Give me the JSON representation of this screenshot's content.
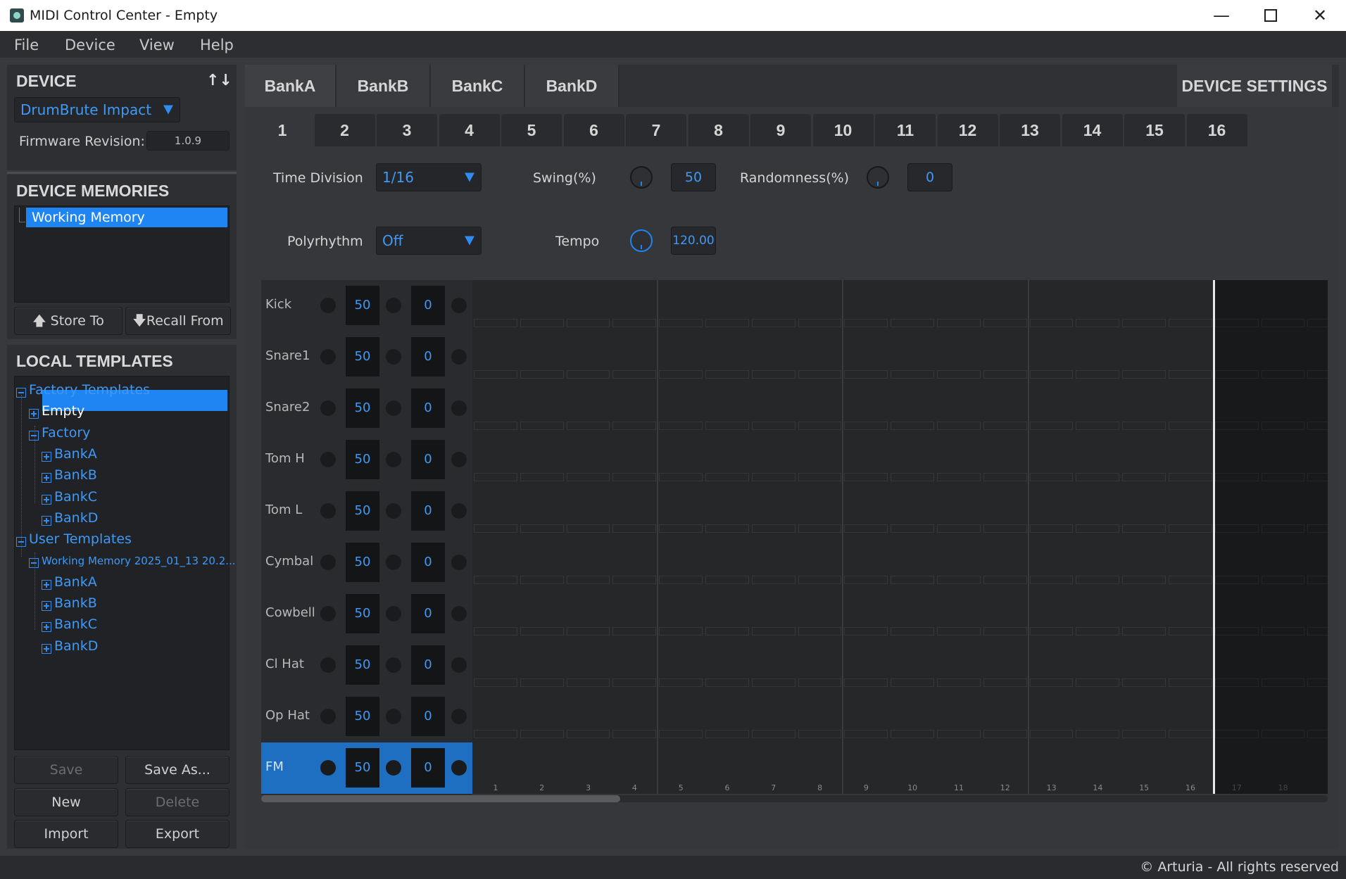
{
  "window": {
    "title": "MIDI Control Center - Empty"
  },
  "menu": [
    "File",
    "Device",
    "View",
    "Help"
  ],
  "device": {
    "heading": "DEVICE",
    "swap_icon": "up-down-arrows-icon",
    "selected_device": "DrumBrute Impact",
    "firmware_label": "Firmware Revision:",
    "firmware_value": "1.0.9"
  },
  "memories": {
    "heading": "DEVICE MEMORIES",
    "items": [
      "Working Memory"
    ],
    "store_label": "Store To",
    "recall_label": "Recall From"
  },
  "templates": {
    "heading": "LOCAL TEMPLATES",
    "tree": [
      {
        "label": "Factory Templates",
        "level": 0,
        "expanded": true
      },
      {
        "label": "Empty",
        "level": 1,
        "expanded": false,
        "selected": true
      },
      {
        "label": "Factory",
        "level": 1,
        "expanded": true
      },
      {
        "label": "BankA",
        "level": 2,
        "expanded": false
      },
      {
        "label": "BankB",
        "level": 2,
        "expanded": false
      },
      {
        "label": "BankC",
        "level": 2,
        "expanded": false
      },
      {
        "label": "BankD",
        "level": 2,
        "expanded": false
      },
      {
        "label": "User Templates",
        "level": 0,
        "expanded": true
      },
      {
        "label": "Working Memory 2025_01_13 20.2...",
        "level": 1,
        "expanded": true
      },
      {
        "label": "BankA",
        "level": 2,
        "expanded": false
      },
      {
        "label": "BankB",
        "level": 2,
        "expanded": false
      },
      {
        "label": "BankC",
        "level": 2,
        "expanded": false
      },
      {
        "label": "BankD",
        "level": 2,
        "expanded": false
      }
    ],
    "buttons": {
      "save": "Save",
      "save_as": "Save As...",
      "new": "New",
      "delete": "Delete",
      "import": "Import",
      "export": "Export"
    }
  },
  "bank_tabs": [
    "BankA",
    "BankB",
    "BankC",
    "BankD"
  ],
  "device_settings_label": "DEVICE SETTINGS",
  "pattern_tabs": [
    "1",
    "2",
    "3",
    "4",
    "5",
    "6",
    "7",
    "8",
    "9",
    "10",
    "11",
    "12",
    "13",
    "14",
    "15",
    "16"
  ],
  "settings": {
    "time_division_label": "Time Division",
    "time_division_value": "1/16",
    "swing_label": "Swing(%)",
    "swing_value": "50",
    "randomness_label": "Randomness(%)",
    "randomness_value": "0",
    "polyrhythm_label": "Polyrhythm",
    "polyrhythm_value": "Off",
    "tempo_label": "Tempo",
    "tempo_value": "120.00"
  },
  "tracks": [
    {
      "name": "Kick",
      "level": "50",
      "value": "0"
    },
    {
      "name": "Snare1",
      "level": "50",
      "value": "0"
    },
    {
      "name": "Snare2",
      "level": "50",
      "value": "0"
    },
    {
      "name": "Tom H",
      "level": "50",
      "value": "0"
    },
    {
      "name": "Tom L",
      "level": "50",
      "value": "0"
    },
    {
      "name": "Cymbal",
      "level": "50",
      "value": "0"
    },
    {
      "name": "Cowbell",
      "level": "50",
      "value": "0"
    },
    {
      "name": "Cl Hat",
      "level": "50",
      "value": "0"
    },
    {
      "name": "Op Hat",
      "level": "50",
      "value": "0"
    },
    {
      "name": "FM",
      "level": "50",
      "value": "0",
      "selected": true
    }
  ],
  "step_labels": [
    "1",
    "2",
    "3",
    "4",
    "5",
    "6",
    "7",
    "8",
    "9",
    "10",
    "11",
    "12",
    "13",
    "14",
    "15",
    "16",
    "17",
    "18",
    "1"
  ],
  "footer": "© Arturia - All rights reserved",
  "colors": {
    "accent": "#1f85f2",
    "text_blue": "#3f99f5",
    "background": "#38393c"
  }
}
